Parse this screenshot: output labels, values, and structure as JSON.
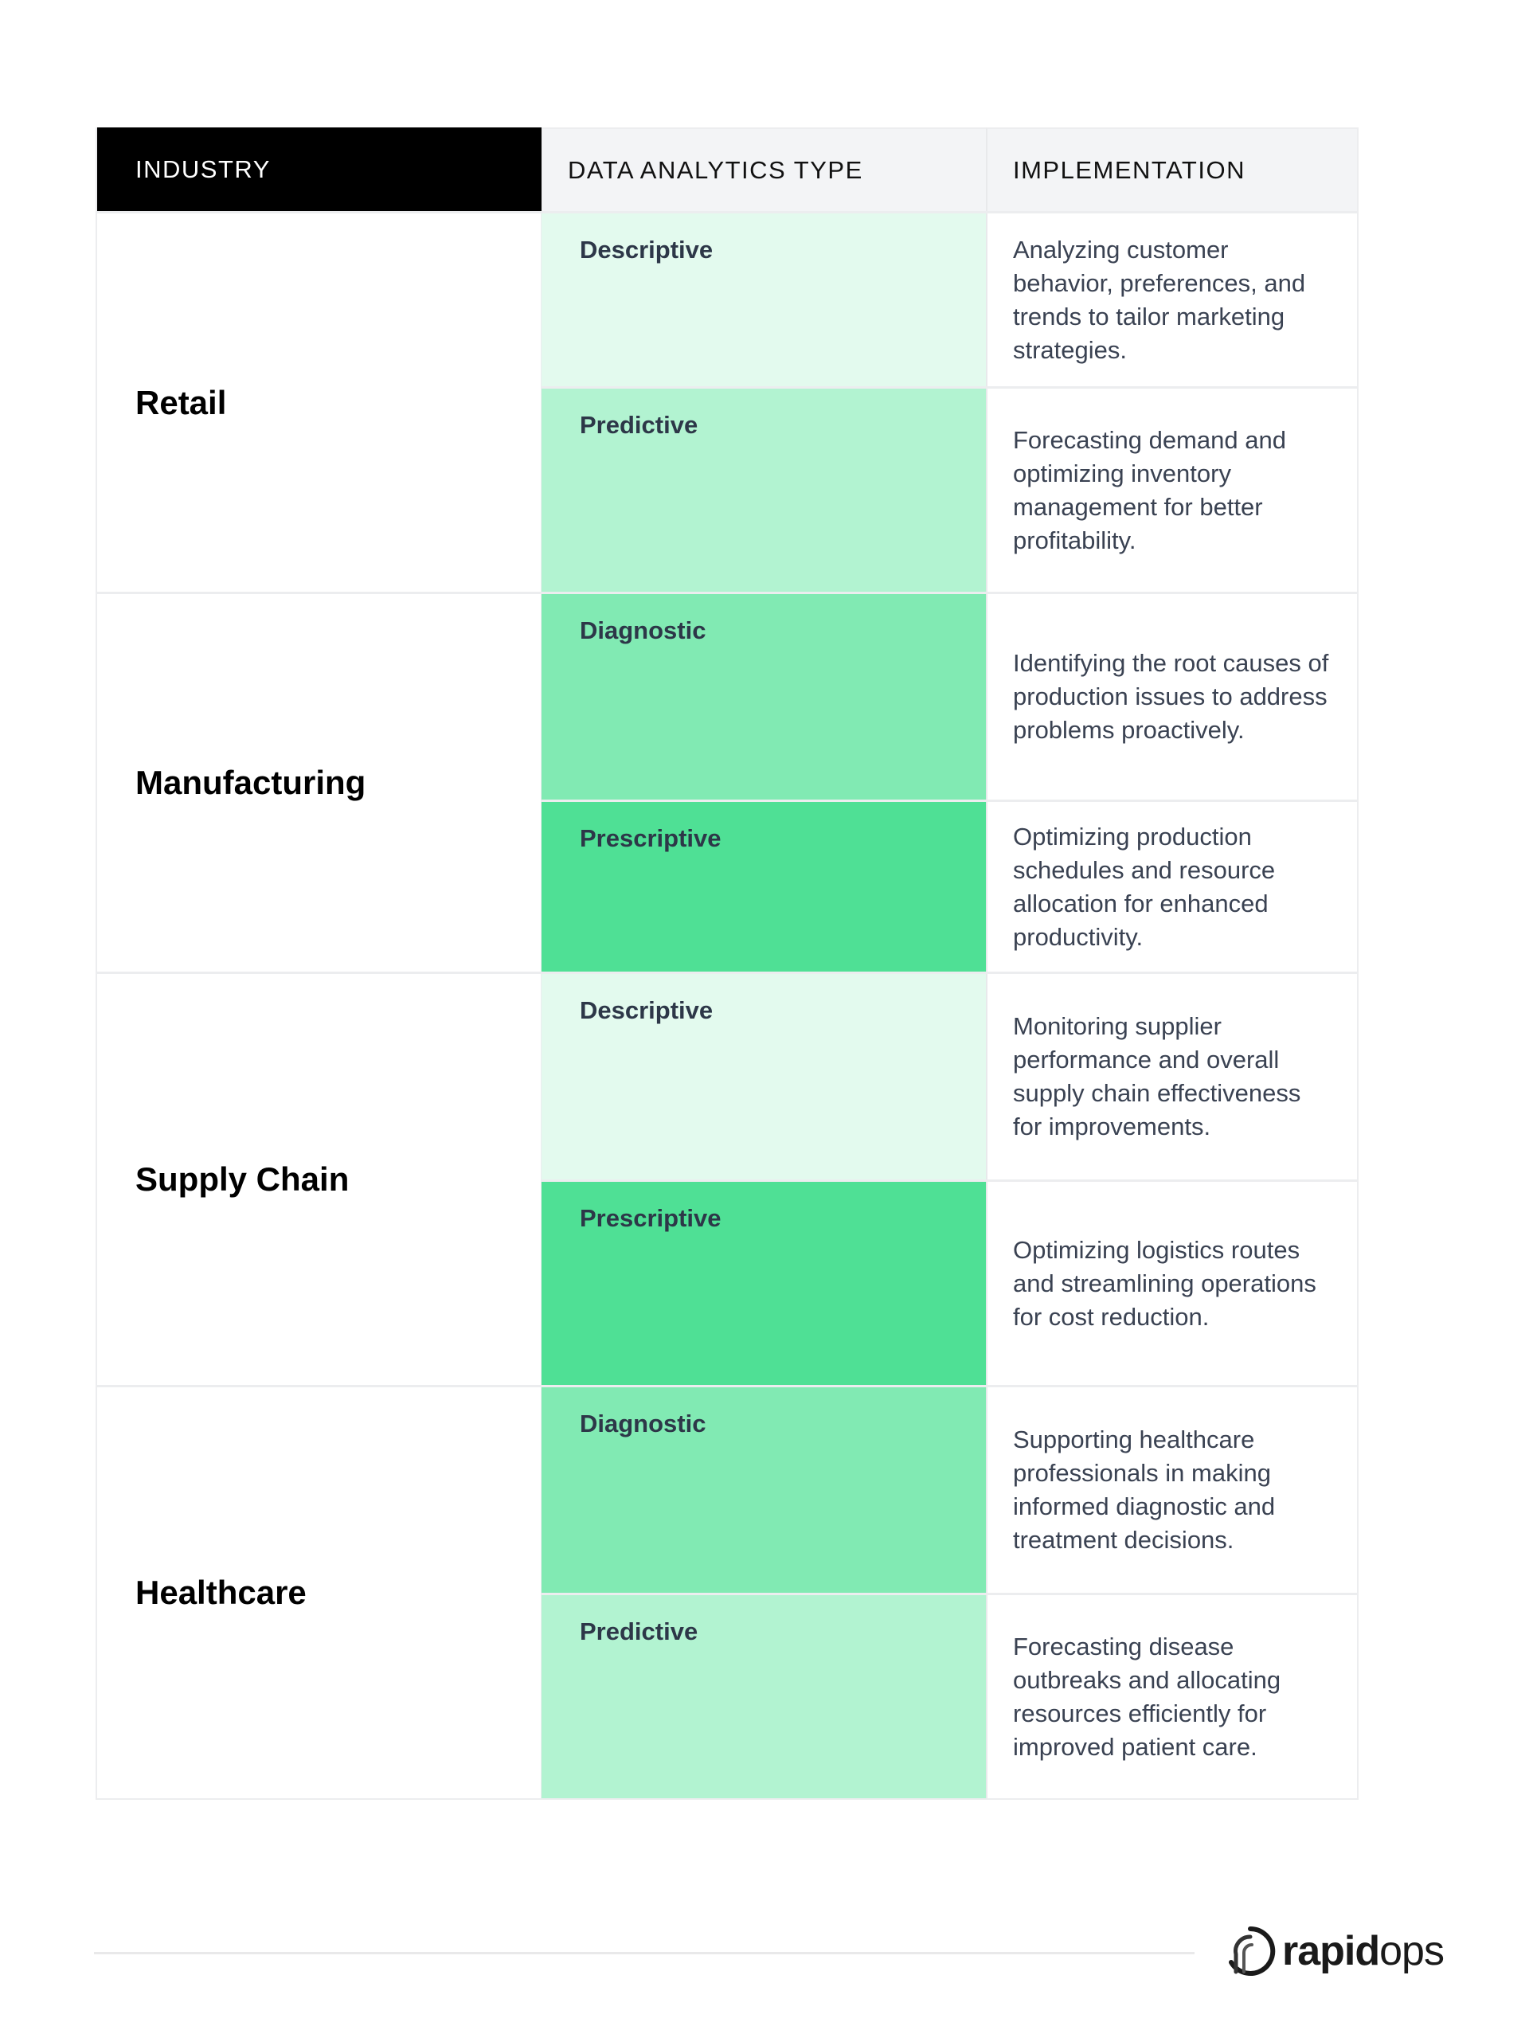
{
  "table": {
    "headers": {
      "industry": "INDUSTRY",
      "type": "DATA ANALYTICS TYPE",
      "implementation": "IMPLEMENTATION"
    },
    "colors": {
      "Descriptive": "#E3FAEE",
      "Predictive": "#B2F3D1",
      "Diagnostic": "#81EAB3",
      "Prescriptive": "#4FE095"
    },
    "groups": [
      {
        "industry": "Retail",
        "rows": [
          {
            "type": "Descriptive",
            "implementation": "Analyzing customer behavior, preferences, and trends to tailor marketing strategies."
          },
          {
            "type": "Predictive",
            "implementation": "Forecasting demand and optimizing inventory management for better profitability."
          }
        ]
      },
      {
        "industry": "Manufacturing",
        "rows": [
          {
            "type": "Diagnostic",
            "implementation": "Identifying the root causes of production issues to address problems proactively."
          },
          {
            "type": "Prescriptive",
            "implementation": "Optimizing production schedules and resource allocation for enhanced productivity."
          }
        ]
      },
      {
        "industry": "Supply Chain",
        "rows": [
          {
            "type": "Descriptive",
            "implementation": "Monitoring supplier performance and overall supply chain effectiveness for improvements."
          },
          {
            "type": "Prescriptive",
            "implementation": "Optimizing logistics routes and streamlining operations for cost reduction."
          }
        ]
      },
      {
        "industry": "Healthcare",
        "rows": [
          {
            "type": "Diagnostic",
            "implementation": "Supporting healthcare professionals in making informed diagnostic and treatment decisions."
          },
          {
            "type": "Predictive",
            "implementation": "Forecasting disease outbreaks and allocating resources efficiently for improved patient care."
          }
        ]
      }
    ]
  },
  "footer": {
    "logo_bold": "rapid",
    "logo_light": "ops",
    "logo_icon": "rapidops-swirl-icon"
  }
}
